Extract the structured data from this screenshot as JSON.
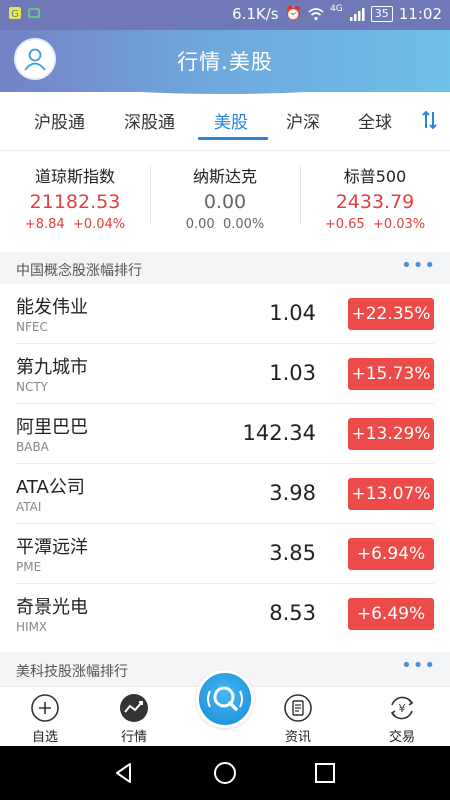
{
  "status_bar": {
    "net_speed": "6.1K/s",
    "network": "4G",
    "battery": "35",
    "time": "11:02"
  },
  "header": {
    "title": "行情.美股"
  },
  "tabs": [
    {
      "label": "沪股通",
      "active": false
    },
    {
      "label": "深股通",
      "active": false
    },
    {
      "label": "美股",
      "active": true
    },
    {
      "label": "沪深",
      "active": false
    },
    {
      "label": "全球",
      "active": false
    }
  ],
  "indices": [
    {
      "name": "道琼斯指数",
      "value": "21182.53",
      "change": "+8.84",
      "percent": "+0.04%",
      "trend": "up"
    },
    {
      "name": "纳斯达克",
      "value": "0.00",
      "change": "0.00",
      "percent": "0.00%",
      "trend": "flat"
    },
    {
      "name": "标普500",
      "value": "2433.79",
      "change": "+0.65",
      "percent": "+0.03%",
      "trend": "up"
    }
  ],
  "sections": [
    {
      "title": "中国概念股涨幅排行",
      "more": "•••"
    },
    {
      "title": "美科技股涨幅排行",
      "more": "•••"
    }
  ],
  "stocks": [
    {
      "name": "能发伟业",
      "code": "NFEC",
      "price": "1.04",
      "change": "+22.35%"
    },
    {
      "name": "第九城市",
      "code": "NCTY",
      "price": "1.03",
      "change": "+15.73%"
    },
    {
      "name": "阿里巴巴",
      "code": "BABA",
      "price": "142.34",
      "change": "+13.29%"
    },
    {
      "name": "ATA公司",
      "code": "ATAI",
      "price": "3.98",
      "change": "+13.07%"
    },
    {
      "name": "平潭远洋",
      "code": "PME",
      "price": "3.85",
      "change": "+6.94%"
    },
    {
      "name": "奇景光电",
      "code": "HIMX",
      "price": "8.53",
      "change": "+6.49%"
    }
  ],
  "bottom_nav": [
    {
      "label": "自选",
      "icon": "plus-circle-icon"
    },
    {
      "label": "行情",
      "icon": "trend-chart-icon"
    },
    {
      "label": "",
      "icon": "search-magnifier-icon"
    },
    {
      "label": "资讯",
      "icon": "document-icon"
    },
    {
      "label": "交易",
      "icon": "yen-exchange-icon"
    }
  ],
  "colors": {
    "accent": "#2a86d8",
    "up": "#e2403d",
    "badge_up": "#ec4b49",
    "header_start": "#7382c4",
    "header_end": "#6ec0e8"
  }
}
